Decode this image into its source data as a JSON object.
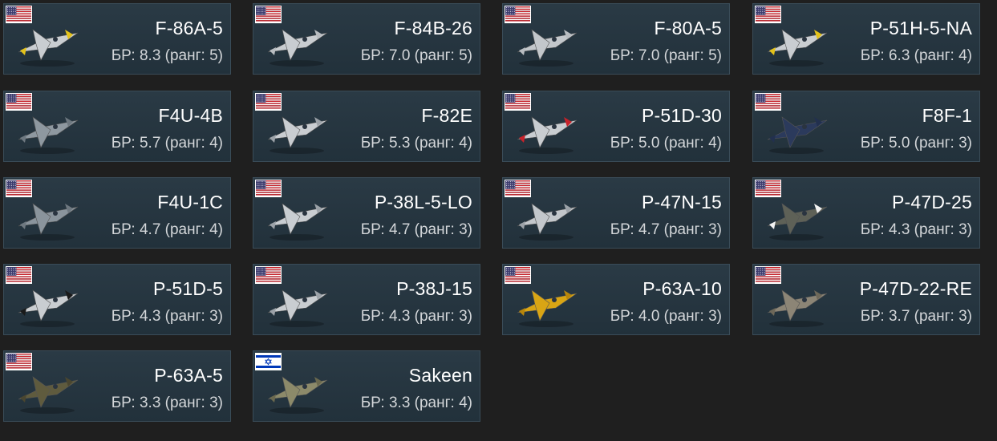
{
  "br_prefix": "БР:",
  "rank_word": "ранг:",
  "aircraft": [
    {
      "name": "F-86A-5",
      "br": "8.3",
      "rank": "5",
      "nation": "usa",
      "color": "#c9cdd1",
      "accent": "#e3c21a"
    },
    {
      "name": "F-84B-26",
      "br": "7.0",
      "rank": "5",
      "nation": "usa",
      "color": "#c9cdd1",
      "accent": "#b8bcc0"
    },
    {
      "name": "F-80A-5",
      "br": "7.0",
      "rank": "5",
      "nation": "usa",
      "color": "#c3c7cb",
      "accent": "#b8bcc0"
    },
    {
      "name": "P-51H-5-NA",
      "br": "6.3",
      "rank": "4",
      "nation": "usa",
      "color": "#c9cdd1",
      "accent": "#e3c21a"
    },
    {
      "name": "F4U-4B",
      "br": "5.7",
      "rank": "4",
      "nation": "usa",
      "color": "#8e98a0",
      "accent": "#6e7880"
    },
    {
      "name": "F-82E",
      "br": "5.3",
      "rank": "4",
      "nation": "usa",
      "color": "#c9cdd1",
      "accent": "#9ca2a8"
    },
    {
      "name": "P-51D-30",
      "br": "5.0",
      "rank": "4",
      "nation": "usa",
      "color": "#c9cdd1",
      "accent": "#c8222a"
    },
    {
      "name": "F8F-1",
      "br": "5.0",
      "rank": "3",
      "nation": "usa",
      "color": "#2b3a5c",
      "accent": "#22304e"
    },
    {
      "name": "F4U-1C",
      "br": "4.7",
      "rank": "4",
      "nation": "usa",
      "color": "#8a949c",
      "accent": "#6e7880"
    },
    {
      "name": "P-38L-5-LO",
      "br": "4.7",
      "rank": "3",
      "nation": "usa",
      "color": "#c9cdd1",
      "accent": "#9ca2a8"
    },
    {
      "name": "P-47N-15",
      "br": "4.7",
      "rank": "3",
      "nation": "usa",
      "color": "#c3c7cb",
      "accent": "#9ca2a8"
    },
    {
      "name": "P-47D-25",
      "br": "4.3",
      "rank": "3",
      "nation": "usa",
      "color": "#5e6157",
      "accent": "#f2f2f2"
    },
    {
      "name": "P-51D-5",
      "br": "4.3",
      "rank": "3",
      "nation": "usa",
      "color": "#c9cdd1",
      "accent": "#1a1a1a"
    },
    {
      "name": "P-38J-15",
      "br": "4.3",
      "rank": "3",
      "nation": "usa",
      "color": "#c9cdd1",
      "accent": "#9ca2a8"
    },
    {
      "name": "P-63A-10",
      "br": "4.0",
      "rank": "3",
      "nation": "usa",
      "color": "#d9a514",
      "accent": "#b8860b"
    },
    {
      "name": "P-47D-22-RE",
      "br": "3.7",
      "rank": "3",
      "nation": "usa",
      "color": "#8c8576",
      "accent": "#6e6859"
    },
    {
      "name": "P-63A-5",
      "br": "3.3",
      "rank": "3",
      "nation": "usa",
      "color": "#5f5b3e",
      "accent": "#4a4630"
    },
    {
      "name": "Sakeen",
      "br": "3.3",
      "rank": "4",
      "nation": "israel",
      "color": "#8c8a6a",
      "accent": "#6b694f"
    }
  ]
}
